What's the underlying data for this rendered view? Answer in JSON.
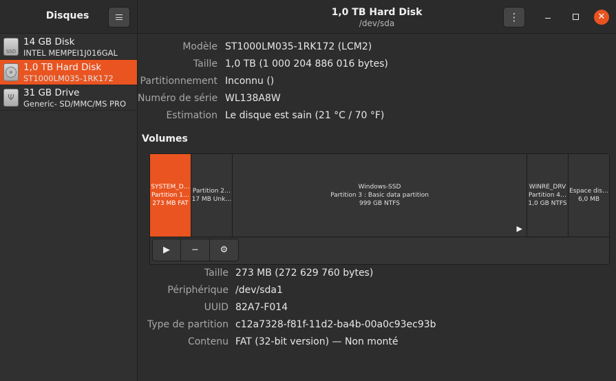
{
  "sidebar": {
    "title": "Disques",
    "menu_icon": "hamburger-menu-icon",
    "disks": [
      {
        "name": "14 GB Disk",
        "sub": "INTEL MEMPEI1J016GAL",
        "icon": "ssd-icon",
        "icon_text": "SSD"
      },
      {
        "name": "1,0 TB Hard Disk",
        "sub": "ST1000LM035-1RK172",
        "icon": "hard-disk-icon",
        "selected": true
      },
      {
        "name": "31 GB Drive",
        "sub": "Generic- SD/MMC/MS PRO",
        "icon": "usb-drive-icon"
      }
    ]
  },
  "header": {
    "title": "1,0 TB Hard Disk",
    "subtitle": "/dev/sda",
    "menu_icon": "vertical-dots-icon",
    "menu_glyph": "⋮",
    "close_glyph": "✕"
  },
  "disk_info": [
    {
      "label": "Modèle",
      "value": "ST1000LM035-1RK172 (LCM2)"
    },
    {
      "label": "Taille",
      "value": "1,0 TB (1 000 204 886 016 bytes)"
    },
    {
      "label": "Partitionnement",
      "value": "Inconnu ()"
    },
    {
      "label": "Numéro de série",
      "value": "WL138A8W"
    },
    {
      "label": "Estimation",
      "value": "Le disque est sain (21 °C / 70 °F)"
    }
  ],
  "volumes": {
    "title": "Volumes",
    "partitions": [
      {
        "lines": [
          "SYSTEM_D…",
          "Partition 1…",
          "273 MB FAT"
        ],
        "selected": true
      },
      {
        "lines": [
          "Partition 2…",
          "17 MB Unk…"
        ]
      },
      {
        "lines": [
          "Windows-SSD",
          "Partition 3 : Basic data partition",
          "999 GB NTFS"
        ],
        "mount_glyph": "▶"
      },
      {
        "lines": [
          "WINRE_DRV",
          "Partition 4…",
          "1,0 GB NTFS"
        ]
      },
      {
        "lines": [
          "Espace dis…",
          "6,0 MB"
        ]
      }
    ],
    "tools": [
      {
        "name": "mount-button",
        "icon": "play-icon",
        "glyph": "▶"
      },
      {
        "name": "delete-partition-button",
        "icon": "minus-icon",
        "glyph": "−"
      },
      {
        "name": "partition-options-button",
        "icon": "gears-icon",
        "glyph": "⚙"
      }
    ]
  },
  "volume_info": [
    {
      "label": "Taille",
      "value": "273 MB (272 629 760 bytes)"
    },
    {
      "label": "Périphérique",
      "value": "/dev/sda1"
    },
    {
      "label": "UUID",
      "value": "82A7-F014"
    },
    {
      "label": "Type de partition",
      "value": "c12a7328-f81f-11d2-ba4b-00a0c93ec93b"
    },
    {
      "label": "Contenu",
      "value": "FAT (32-bit version) — Non monté"
    }
  ],
  "colors": {
    "accent": "#e95420",
    "background": "#2d2d2d",
    "sidebar": "#303030"
  }
}
